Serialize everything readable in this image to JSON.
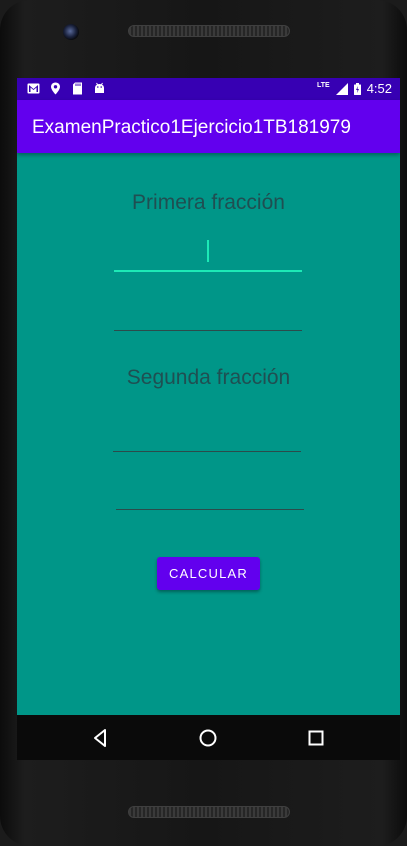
{
  "status_bar": {
    "time": "4:52",
    "network": "LTE",
    "left_icons": [
      "gmail-icon",
      "location-icon",
      "sd-card-icon",
      "android-icon"
    ]
  },
  "app_bar": {
    "title": "ExamenPractico1Ejercicio1TB181979"
  },
  "form": {
    "first_label": "Primera fracción",
    "second_label": "Segunda fracción",
    "first_numerator": "",
    "first_denominator": "",
    "second_numerator": "",
    "second_denominator": "",
    "calculate_button": "CALCULAR"
  },
  "nav_bar": {
    "buttons": [
      "back-icon",
      "home-icon",
      "recents-icon"
    ]
  },
  "colors": {
    "primary": "#6200ee",
    "primary_dark": "#3700b3",
    "background": "#009688",
    "accent": "#1de9b6"
  }
}
